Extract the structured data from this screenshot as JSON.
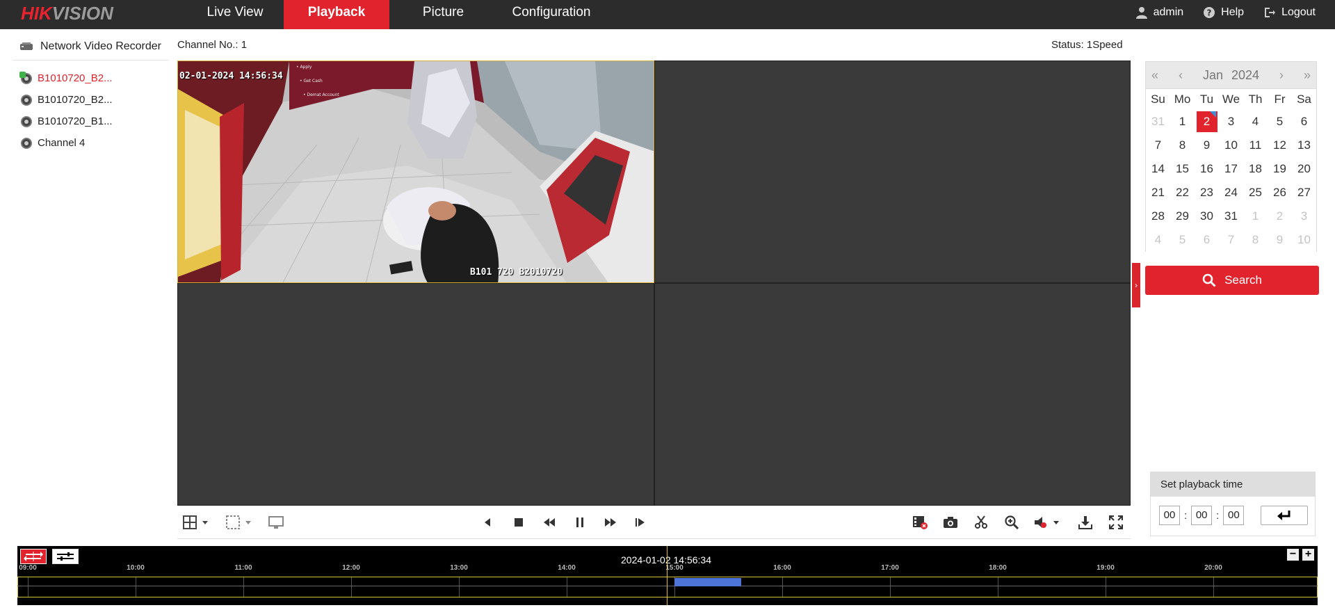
{
  "brand": {
    "part1": "HIK",
    "part2": "VISION"
  },
  "nav": {
    "live_view": "Live View",
    "playback": "Playback",
    "picture": "Picture",
    "configuration": "Configuration"
  },
  "topright": {
    "user": "admin",
    "help": "Help",
    "logout": "Logout"
  },
  "tree": {
    "root": "Network Video Recorder",
    "items": [
      "B1010720_B2...",
      "B1010720_B2...",
      "B1010720_B1...",
      "Channel 4"
    ]
  },
  "info": {
    "channel": "Channel No.: 1",
    "status": "Status: 1Speed"
  },
  "video": {
    "timestamp": "02-01-2024 14:56:34",
    "label": "B101 720 B2010720"
  },
  "calendar": {
    "month": "Jan",
    "year": "2024",
    "dow": [
      "Su",
      "Mo",
      "Tu",
      "We",
      "Th",
      "Fr",
      "Sa"
    ],
    "days": [
      "31",
      "1",
      "2",
      "3",
      "4",
      "5",
      "6",
      "7",
      "8",
      "9",
      "10",
      "11",
      "12",
      "13",
      "14",
      "15",
      "16",
      "17",
      "18",
      "19",
      "20",
      "21",
      "22",
      "23",
      "24",
      "25",
      "26",
      "27",
      "28",
      "29",
      "30",
      "31",
      "1",
      "2",
      "3",
      "4",
      "5",
      "6",
      "7",
      "8",
      "9",
      "10"
    ],
    "selected_day": "2"
  },
  "search": {
    "label": "Search"
  },
  "playback_time": {
    "title": "Set playback time",
    "hh": "00",
    "mm": "00",
    "ss": "00"
  },
  "timeline": {
    "current": "2024-01-02 14:56:34",
    "ticks": [
      "09:00",
      "10:00",
      "11:00",
      "12:00",
      "13:00",
      "14:00",
      "15:00",
      "16:00",
      "17:00",
      "18:00",
      "19:00",
      "20:00"
    ],
    "recording_start": "15:00",
    "recording_end": "15:37"
  },
  "colors": {
    "brand_red": "#e0232c",
    "recording_blue": "#4d74d8",
    "track_yellow": "#d6c23a"
  }
}
